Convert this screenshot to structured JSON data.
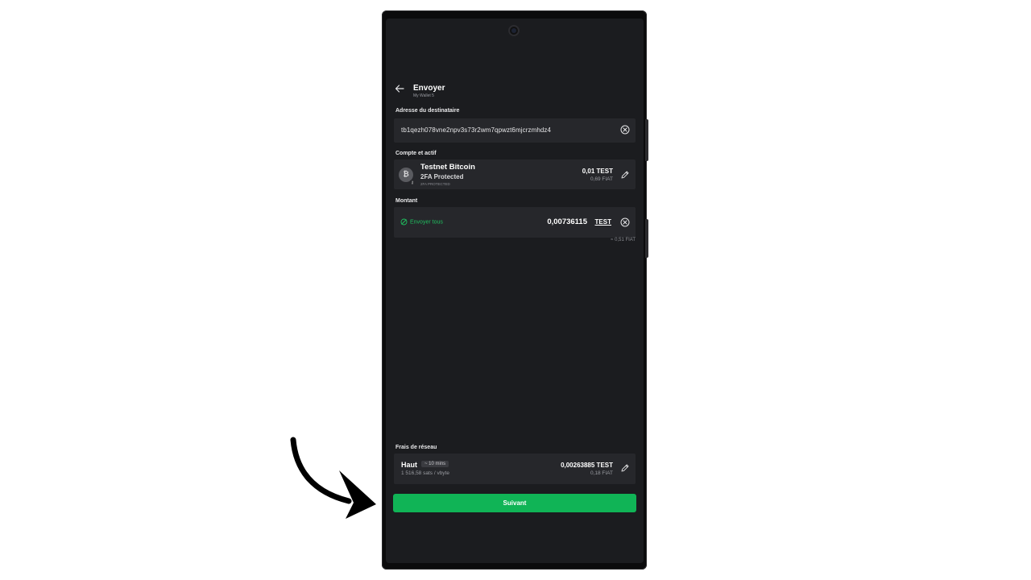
{
  "header": {
    "title": "Envoyer",
    "subtitle": "My Wallet 5",
    "back_icon": "arrow-left-icon"
  },
  "recipient": {
    "label": "Adresse du destinataire",
    "address": "tb1qezh078vne2npv3s73r2wm7qpwzt6mjcrzmhdz4",
    "clear_icon": "clear-circle-icon"
  },
  "account": {
    "label": "Compte et actif",
    "name": "Testnet Bitcoin",
    "subtitle": "2FA Protected",
    "tag": "2FA PROTECTED",
    "balance": "0,01 TEST",
    "fiat": "0,69 FIAT",
    "coin_symbol": "₿",
    "edit_icon": "pencil-icon"
  },
  "amount": {
    "label": "Montant",
    "send_all_label": "Envoyer tous",
    "value": "0,00736115",
    "unit": "TEST",
    "approx": "≈ 0,51 FIAT"
  },
  "fee": {
    "label": "Frais de réseau",
    "name": "Haut",
    "time": "~ 10 mins",
    "rate": "1 516,58 sats / vbyte",
    "value": "0,00263885 TEST",
    "fiat": "0,18 FIAT"
  },
  "next_button": "Suivant",
  "colors": {
    "accent": "#10b456",
    "background": "#1b1c1f",
    "card": "#26272b"
  }
}
